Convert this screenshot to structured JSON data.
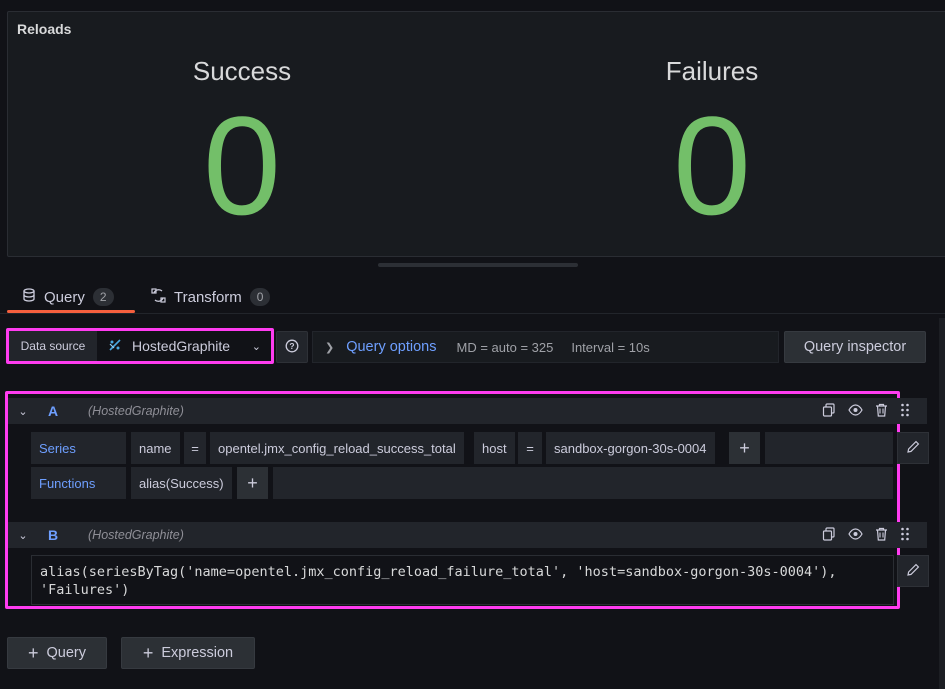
{
  "panel": {
    "title": "Reloads",
    "stats": [
      {
        "label": "Success",
        "value": "0"
      },
      {
        "label": "Failures",
        "value": "0"
      }
    ],
    "value_color": "#73bf69"
  },
  "tabs": [
    {
      "label": "Query",
      "count": "2",
      "active": true
    },
    {
      "label": "Transform",
      "count": "0",
      "active": false
    }
  ],
  "datasource": {
    "label": "Data source",
    "selected": "HostedGraphite"
  },
  "query_options": {
    "title": "Query options",
    "md": "MD = auto = 325",
    "interval": "Interval = 10s"
  },
  "query_inspector_label": "Query inspector",
  "queries": [
    {
      "letter": "A",
      "datasource": "(HostedGraphite)",
      "series_label": "Series",
      "tags": [
        "name",
        "=",
        "opentel.jmx_config_reload_success_total",
        "host",
        "=",
        "sandbox-gorgon-30s-0004"
      ],
      "functions_label": "Functions",
      "functions": [
        "alias(Success)"
      ]
    },
    {
      "letter": "B",
      "datasource": "(HostedGraphite)",
      "raw_line1": "alias(seriesByTag('name=opentel.jmx_config_reload_failure_total', 'host=sandbox-gorgon-30s-0004'),",
      "raw_line2": "'Failures')"
    }
  ],
  "add_buttons": {
    "query": "Query",
    "expression": "Expression"
  },
  "highlight_color": "#ff3cf0",
  "accent_color": "#6e9fff"
}
